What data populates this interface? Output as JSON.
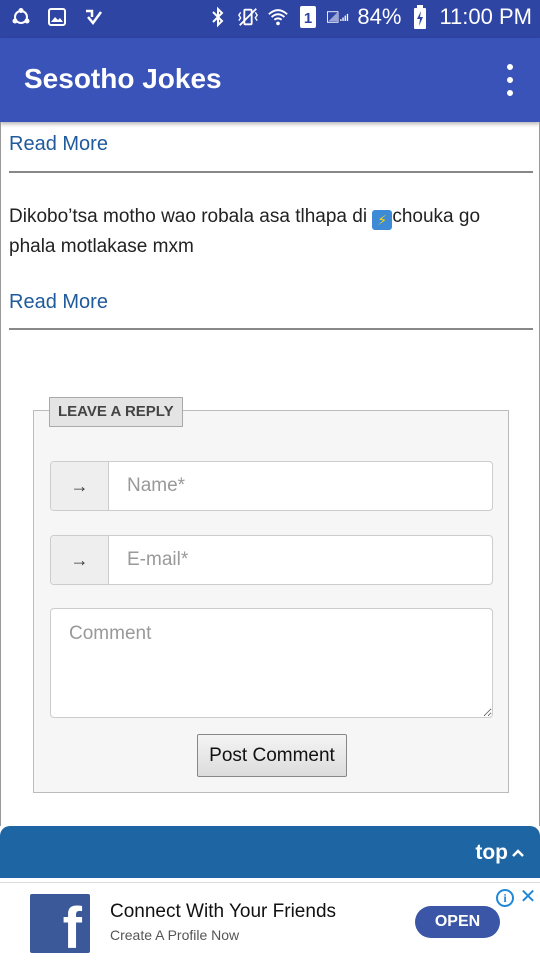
{
  "status_bar": {
    "battery": "84%",
    "time": "11:00 PM",
    "sim_slot": "1",
    "icons": [
      "sync-icon",
      "image-icon",
      "check-icon",
      "bluetooth-icon",
      "vibrate-icon",
      "wifi-icon",
      "sim-icon",
      "signal-icon",
      "battery-icon"
    ]
  },
  "app_bar": {
    "title": "Sesotho Jokes",
    "menu_icon": "more-vert-icon"
  },
  "content": {
    "read_more_1": "Read More",
    "joke_text": "Dikobo’tsa motho wao robala asa tlhapa di ",
    "joke_text_end": "chouka go phala motlakase mxm",
    "emoji_icon": "high-voltage-icon",
    "read_more_2": "Read More"
  },
  "reply_form": {
    "legend": "LEAVE A REPLY",
    "name_placeholder": "Name*",
    "email_placeholder": "E-mail*",
    "comment_placeholder": "Comment",
    "addon_arrow": "→",
    "post_button": "Post Comment"
  },
  "top_bar": {
    "label": "top",
    "caret": "^"
  },
  "ad": {
    "title": "Connect With Your Friends",
    "subtitle": "Create A Profile Now",
    "button": "OPEN",
    "logo_letter": "f",
    "info_glyph": "i",
    "close_glyph": "✕"
  },
  "colors": {
    "status_bar": "#2f45a4",
    "app_bar": "#3a53b9",
    "link": "#1e5a9c",
    "top_bar": "#1e65a4",
    "facebook": "#3b5998"
  }
}
